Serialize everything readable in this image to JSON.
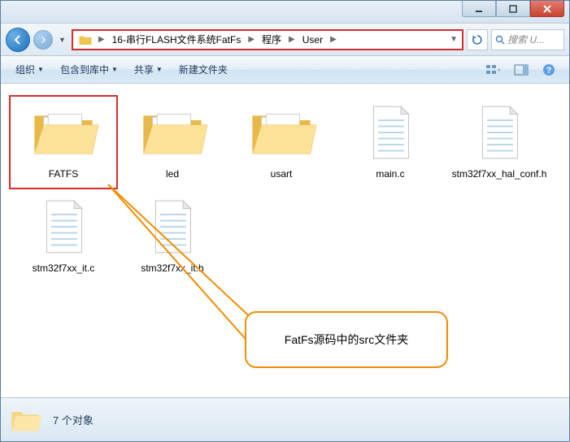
{
  "titlebar": {
    "min": "minimize",
    "max": "maximize",
    "close": "close"
  },
  "nav": {
    "breadcrumb": [
      "16-串行FLASH文件系统FatFs",
      "程序",
      "User"
    ],
    "search_placeholder": "搜索 U..."
  },
  "toolbar": {
    "organize": "组织",
    "include": "包含到库中",
    "share": "共享",
    "newfolder": "新建文件夹"
  },
  "items": [
    {
      "name": "FATFS",
      "type": "folder",
      "selected": true
    },
    {
      "name": "led",
      "type": "folder",
      "selected": false
    },
    {
      "name": "usart",
      "type": "folder",
      "selected": false
    },
    {
      "name": "main.c",
      "type": "file",
      "selected": false
    },
    {
      "name": "stm32f7xx_hal_conf.h",
      "type": "file",
      "selected": false
    },
    {
      "name": "stm32f7xx_it.c",
      "type": "file",
      "selected": false
    },
    {
      "name": "stm32f7xx_it.h",
      "type": "file",
      "selected": false
    }
  ],
  "callout": {
    "text": "FatFs源码中的src文件夹"
  },
  "status": {
    "text": "7 个对象"
  }
}
